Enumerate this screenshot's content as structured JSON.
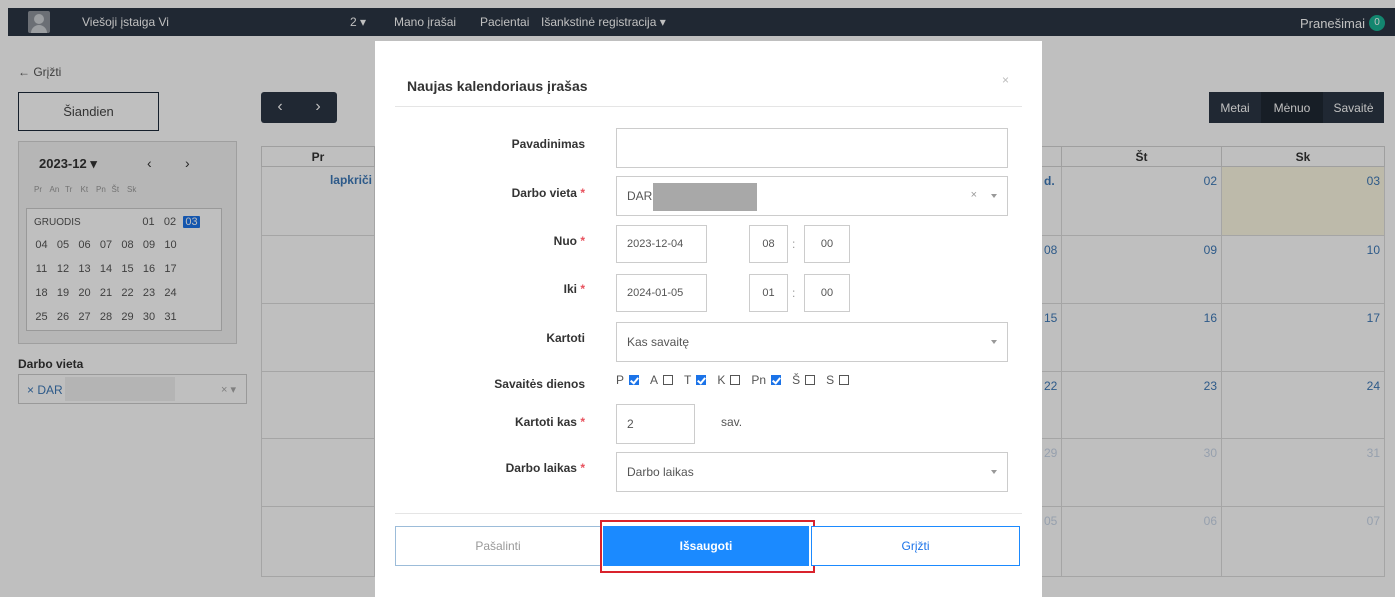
{
  "navbar": {
    "org": "Viešoji įstaiga Vi",
    "count_dropdown": "2 ▾",
    "my_records": "Mano įrašai",
    "patients": "Pacientai",
    "prereg": "Išankstinė registracija ▾",
    "notifications": "Pranešimai",
    "notifications_count": "0"
  },
  "left_panel": {
    "back": "← Grįžti",
    "today": "Šiandien",
    "mini_calendar": {
      "month_label": "2023-12 ▾",
      "prev": "‹",
      "next": "›",
      "weekdays": [
        "Pr",
        "An",
        "Tr",
        "Kt",
        "Pn",
        "Št",
        "Sk"
      ],
      "month_name": "GRUODIS",
      "first_row": [
        "01",
        "02",
        "03"
      ],
      "selected_day": "03",
      "rows": [
        [
          "04",
          "05",
          "06",
          "07",
          "08",
          "09",
          "10"
        ],
        [
          "11",
          "12",
          "13",
          "14",
          "15",
          "16",
          "17"
        ],
        [
          "18",
          "19",
          "20",
          "21",
          "22",
          "23",
          "24"
        ],
        [
          "25",
          "26",
          "27",
          "28",
          "29",
          "30",
          "31"
        ]
      ]
    },
    "workplace_label": "Darbo vieta",
    "workplace_tag": "× DAR",
    "workplace_icons": "× ▾"
  },
  "calendar": {
    "prev": "‹",
    "next": "›",
    "views": [
      "Metai",
      "Mėnuo",
      "Savaitė"
    ],
    "active_view": "Mėnuo",
    "headers": {
      "mon": "Pr",
      "sat": "Št",
      "sun": "Sk"
    },
    "first_cell_label": "lapkriči",
    "fri_first_label": "d.",
    "fri_days": [
      "08",
      "15",
      "22",
      "29",
      "05"
    ],
    "sat_days": [
      "02",
      "09",
      "16",
      "23",
      "30",
      "06"
    ],
    "sun_days": [
      "03",
      "10",
      "17",
      "24",
      "31",
      "07"
    ]
  },
  "modal": {
    "title": "Naujas kalendoriaus įrašas",
    "close": "×",
    "fields": {
      "name_label": "Pavadinimas",
      "name_value": "",
      "workplace_label": "Darbo vieta",
      "workplace_value": "DAR",
      "workplace_clear": "×",
      "from_label": "Nuo",
      "from_date": "2023-12-04",
      "from_hour": "08",
      "from_min": "00",
      "to_label": "Iki",
      "to_date": "2024-01-05",
      "to_hour": "01",
      "to_min": "00",
      "time_sep": ":",
      "repeat_label": "Kartoti",
      "repeat_value": "Kas savaitę",
      "weekdays_label": "Savaitės dienos",
      "weekdays": [
        {
          "label": "P",
          "checked": true
        },
        {
          "label": "A",
          "checked": false
        },
        {
          "label": "T",
          "checked": true
        },
        {
          "label": "K",
          "checked": false
        },
        {
          "label": "Pn",
          "checked": true
        },
        {
          "label": "Š",
          "checked": false
        },
        {
          "label": "S",
          "checked": false
        }
      ],
      "repeat_every_label": "Kartoti kas",
      "repeat_every_value": "2",
      "repeat_every_unit": "sav.",
      "work_time_label": "Darbo laikas",
      "work_time_value": "Darbo laikas",
      "required_mark": "*"
    },
    "buttons": {
      "delete": "Pašalinti",
      "save": "Išsaugoti",
      "back": "Grįžti"
    }
  },
  "colors": {
    "navbar": "#2b3645",
    "primary": "#1b8aff",
    "highlight": "#d9232d",
    "today_cell": "#fcf8e3"
  }
}
